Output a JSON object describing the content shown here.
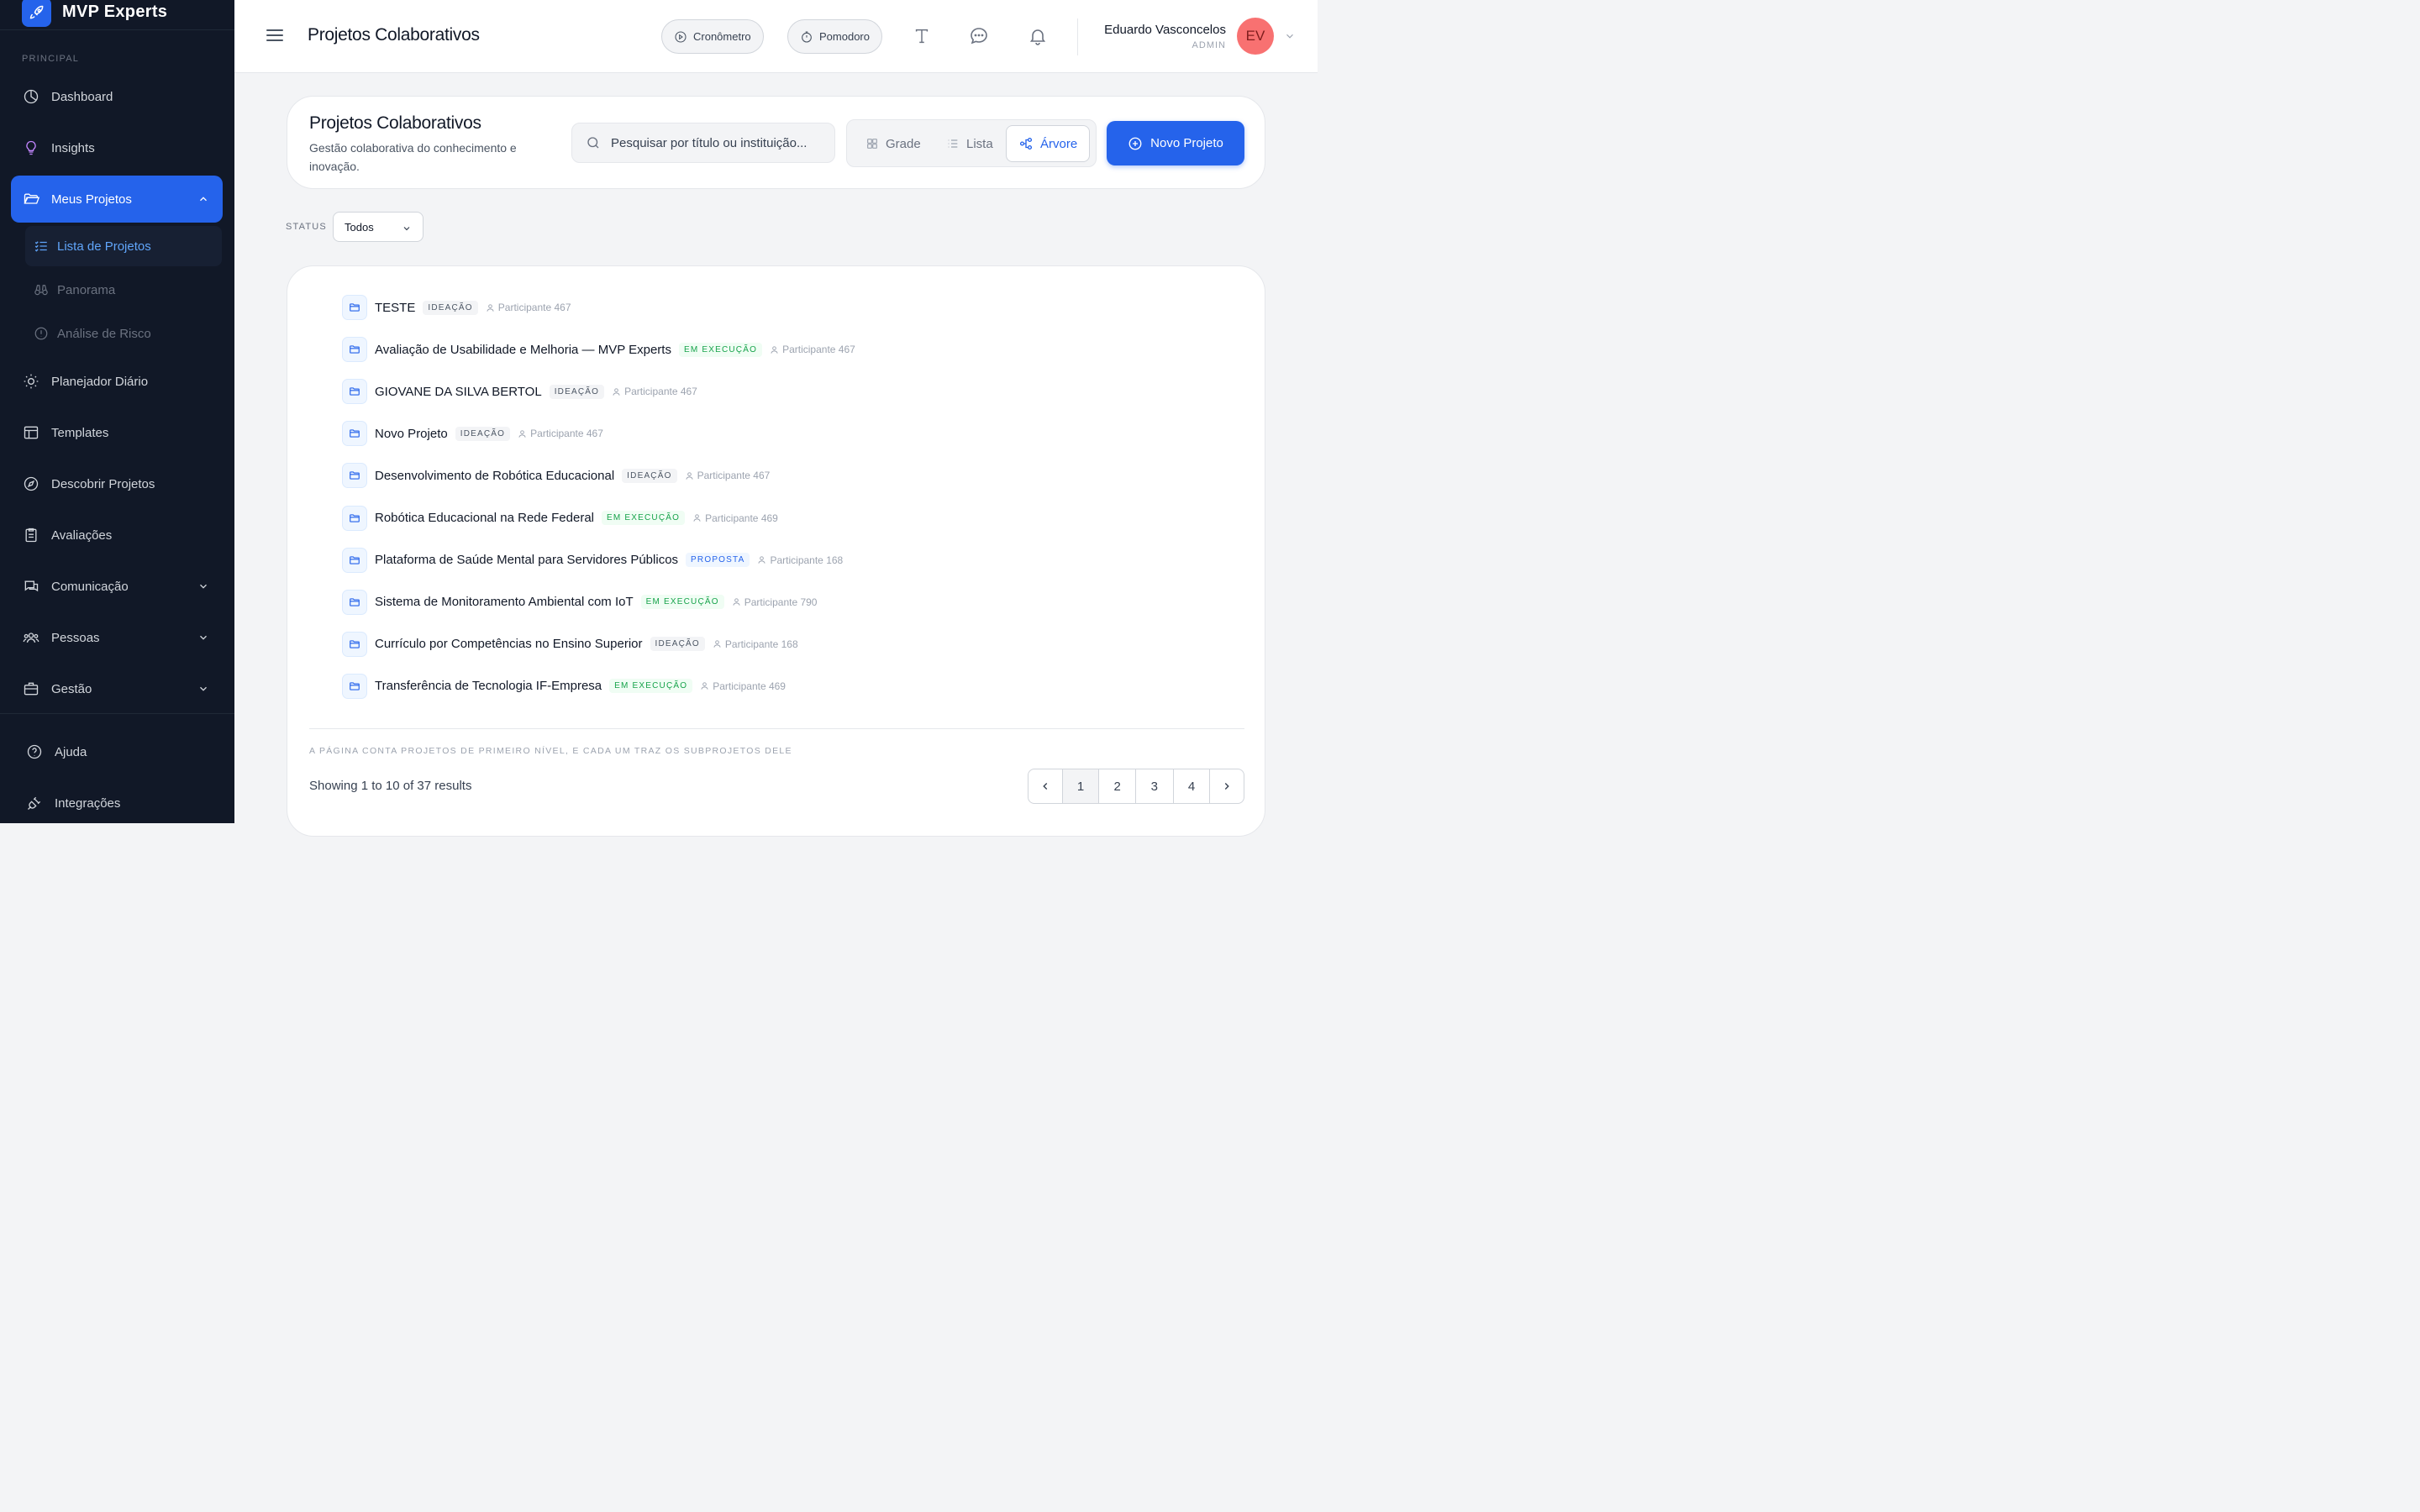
{
  "brand": {
    "name": "MVP Experts",
    "logo_icon": "rocket-icon"
  },
  "sidebar": {
    "section_label": "PRINCIPAL",
    "items": [
      {
        "label": "Dashboard",
        "icon": "chart-pie-icon"
      },
      {
        "label": "Insights",
        "icon": "lightbulb-icon"
      },
      {
        "label": "Meus Projetos",
        "icon": "folder-open-icon"
      },
      {
        "label": "Planejador Diário",
        "icon": "sun-icon"
      },
      {
        "label": "Templates",
        "icon": "layout-icon"
      },
      {
        "label": "Descobrir Projetos",
        "icon": "compass-icon"
      },
      {
        "label": "Avaliações",
        "icon": "clipboard-icon"
      },
      {
        "label": "Comunicação",
        "icon": "chat-icon"
      },
      {
        "label": "Pessoas",
        "icon": "users-icon"
      },
      {
        "label": "Gestão",
        "icon": "briefcase-icon"
      }
    ],
    "sub_items": [
      {
        "label": "Lista de Projetos",
        "icon": "list-check-icon"
      },
      {
        "label": "Panorama",
        "icon": "binoculars-icon"
      },
      {
        "label": "Análise de Risco",
        "icon": "alert-circle-icon"
      }
    ],
    "footer_items": [
      {
        "label": "Ajuda",
        "icon": "help-circle-icon"
      },
      {
        "label": "Integrações",
        "icon": "plug-icon"
      }
    ],
    "active_color": "#2563eb"
  },
  "header": {
    "title": "Projetos Colaborativos",
    "timer_label": "Cronômetro",
    "pomodoro_label": "Pomodoro",
    "user_name": "Eduardo Vasconcelos",
    "user_role": "ADMIN",
    "user_initials": "EV"
  },
  "top_card": {
    "title": "Projetos Colaborativos",
    "subtitle": "Gestão colaborativa do conhecimento e inovação.",
    "search_placeholder": "Pesquisar por título ou instituição...",
    "views": [
      "Grade",
      "Lista",
      "Árvore"
    ],
    "selected_view": "Árvore",
    "new_button": "Novo Projeto"
  },
  "filter": {
    "status_label": "STATUS",
    "status_value": "Todos"
  },
  "projects": [
    {
      "title": "TESTE",
      "status": "IDEAÇÃO",
      "kind": "ideacao",
      "participant": "Participante 467"
    },
    {
      "title": "Avaliação de Usabilidade e Melhoria — MVP Experts",
      "status": "EM EXECUÇÃO",
      "kind": "execucao",
      "participant": "Participante 467"
    },
    {
      "title": "GIOVANE DA SILVA BERTOL",
      "status": "IDEAÇÃO",
      "kind": "ideacao",
      "participant": "Participante 467"
    },
    {
      "title": "Novo Projeto",
      "status": "IDEAÇÃO",
      "kind": "ideacao",
      "participant": "Participante 467"
    },
    {
      "title": "Desenvolvimento de Robótica Educacional",
      "status": "IDEAÇÃO",
      "kind": "ideacao",
      "participant": "Participante 467"
    },
    {
      "title": "Robótica Educacional na Rede Federal",
      "status": "EM EXECUÇÃO",
      "kind": "execucao",
      "participant": "Participante 469"
    },
    {
      "title": "Plataforma de Saúde Mental para Servidores Públicos",
      "status": "PROPOSTA",
      "kind": "proposta",
      "participant": "Participante 168"
    },
    {
      "title": "Sistema de Monitoramento Ambiental com IoT",
      "status": "EM EXECUÇÃO",
      "kind": "execucao",
      "participant": "Participante 790"
    },
    {
      "title": "Currículo por Competências no Ensino Superior",
      "status": "IDEAÇÃO",
      "kind": "ideacao",
      "participant": "Participante 168"
    },
    {
      "title": "Transferência de Tecnologia IF-Empresa",
      "status": "EM EXECUÇÃO",
      "kind": "execucao",
      "participant": "Participante 469"
    }
  ],
  "list_footer": {
    "note": "A PÁGINA CONTA PROJETOS DE PRIMEIRO NÍVEL, E CADA UM TRAZ OS SUBPROJETOS DELE",
    "showing": "Showing 1 to 10 of 37 results",
    "pages": [
      "1",
      "2",
      "3",
      "4"
    ],
    "current_page": "1"
  }
}
